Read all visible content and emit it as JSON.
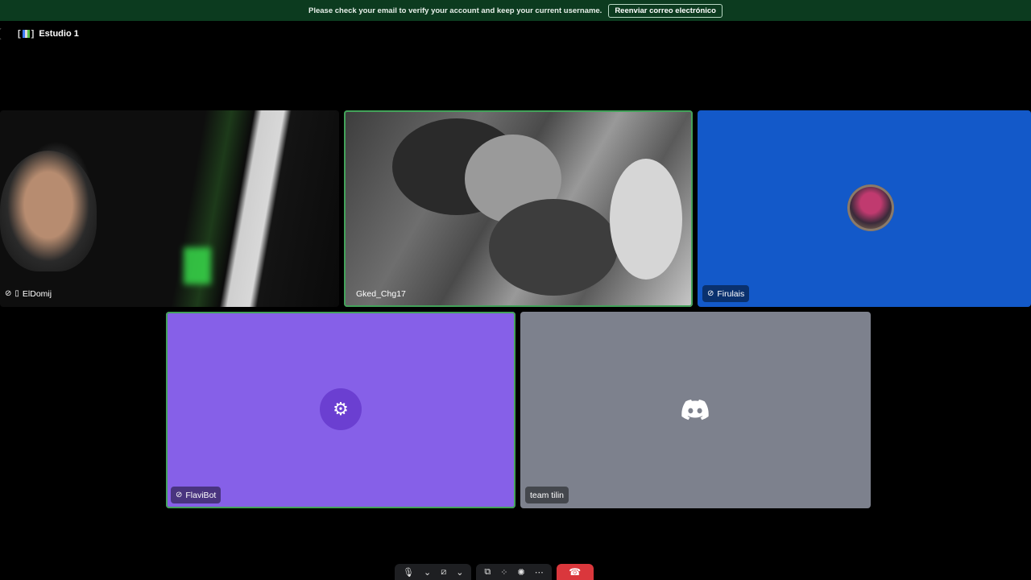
{
  "notice": {
    "message": "Please check your email to verify your account and keep your current username.",
    "button_label": "Reenviar correo electrónico"
  },
  "header": {
    "channel_emoji_left": "[",
    "channel_emoji_right": "]",
    "channel_name": "Estudio 1"
  },
  "participants": [
    {
      "name": "ElDomij",
      "state": "deafened-mobile",
      "tile": "camera"
    },
    {
      "name": "Gked_Chg17",
      "state": "speaking",
      "tile": "camera"
    },
    {
      "name": "Firulais",
      "state": "deafened",
      "tile": "avatar",
      "color": "#1359c9"
    },
    {
      "name": "FlaviBot",
      "state": "deafened",
      "tile": "avatar",
      "color": "#8660e8"
    },
    {
      "name": "team tilin",
      "state": "normal",
      "tile": "avatar",
      "color": "#7d818d"
    }
  ],
  "controls": {
    "mic_icon": "microphone-icon",
    "camera_icon": "camera-off-icon",
    "share_icon": "screen-share-icon",
    "activity_icon": "activity-icon",
    "effects_icon": "soundboard-icon",
    "more_icon": "more-icon",
    "end_icon": "phone-hangup-icon"
  },
  "colors": {
    "notice_bg": "#0c3b1f",
    "speaking_border": "#43a25a",
    "end_call": "#da373c"
  }
}
